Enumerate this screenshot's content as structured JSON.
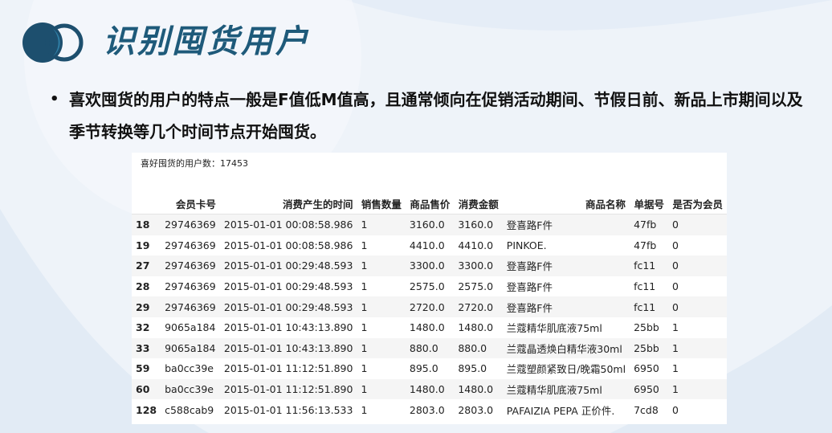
{
  "title": "识别囤货用户",
  "bullet": "喜欢囤货的用户的特点一般是F值低M值高，且通常倾向在促销活动期间、节假日前、新品上市期间以及季节转换等几个时间节点开始囤货。",
  "panel": {
    "count_line": "喜好囤货的用户数：17453"
  },
  "table": {
    "columns": [
      "",
      "会员卡号",
      "消费产生的时间",
      "销售数量",
      "商品售价",
      "消费金额",
      "商品名称",
      "单据号",
      "是否为会员"
    ],
    "rows": [
      {
        "idx": "18",
        "card": "29746369",
        "time": "2015-01-01 00:08:58.986",
        "qty": "1",
        "price": "3160.0",
        "amount": "3160.0",
        "name": "登喜路F件",
        "doc": "47fb",
        "member": "0"
      },
      {
        "idx": "19",
        "card": "29746369",
        "time": "2015-01-01 00:08:58.986",
        "qty": "1",
        "price": "4410.0",
        "amount": "4410.0",
        "name": "PINKOE.",
        "doc": "47fb",
        "member": "0"
      },
      {
        "idx": "27",
        "card": "29746369",
        "time": "2015-01-01 00:29:48.593",
        "qty": "1",
        "price": "3300.0",
        "amount": "3300.0",
        "name": "登喜路F件",
        "doc": "fc11",
        "member": "0"
      },
      {
        "idx": "28",
        "card": "29746369",
        "time": "2015-01-01 00:29:48.593",
        "qty": "1",
        "price": "2575.0",
        "amount": "2575.0",
        "name": "登喜路F件",
        "doc": "fc11",
        "member": "0"
      },
      {
        "idx": "29",
        "card": "29746369",
        "time": "2015-01-01 00:29:48.593",
        "qty": "1",
        "price": "2720.0",
        "amount": "2720.0",
        "name": "登喜路F件",
        "doc": "fc11",
        "member": "0"
      },
      {
        "idx": "32",
        "card": "9065a184",
        "time": "2015-01-01 10:43:13.890",
        "qty": "1",
        "price": "1480.0",
        "amount": "1480.0",
        "name": "兰蔻精华肌底液75ml",
        "doc": "25bb",
        "member": "1"
      },
      {
        "idx": "33",
        "card": "9065a184",
        "time": "2015-01-01 10:43:13.890",
        "qty": "1",
        "price": "880.0",
        "amount": "880.0",
        "name": "兰蔻晶透焕白精华液30ml",
        "doc": "25bb",
        "member": "1"
      },
      {
        "idx": "59",
        "card": "ba0cc39e",
        "time": "2015-01-01 11:12:51.890",
        "qty": "1",
        "price": "895.0",
        "amount": "895.0",
        "name": "兰蔻塑颜紧致日/晚霜50ml",
        "doc": "6950",
        "member": "1"
      },
      {
        "idx": "60",
        "card": "ba0cc39e",
        "time": "2015-01-01 11:12:51.890",
        "qty": "1",
        "price": "1480.0",
        "amount": "1480.0",
        "name": "兰蔻精华肌底液75ml",
        "doc": "6950",
        "member": "1"
      },
      {
        "idx": "128",
        "card": "c588cab9",
        "time": "2015-01-01 11:56:13.533",
        "qty": "1",
        "price": "2803.0",
        "amount": "2803.0",
        "name": "PAFAIZIA PEPA 正价件.",
        "doc": "7cd8",
        "member": "0"
      }
    ]
  },
  "colors": {
    "title": "#1e5a7a",
    "logo_dark": "#1d4f6e",
    "logo_light": "#2f7fa6",
    "background": "#eef3f9"
  }
}
